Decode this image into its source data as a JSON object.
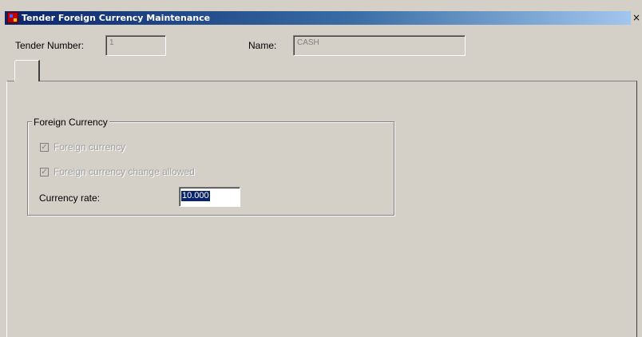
{
  "window": {
    "title": "Tender Foreign Currency Maintenance",
    "close_glyph": "×",
    "icon": "app-grid-icon"
  },
  "header": {
    "tender_number_label": "Tender Number:",
    "tender_number_value": "1",
    "name_label": "Name:",
    "name_value": "CASH"
  },
  "tabs": [
    {
      "label": ""
    }
  ],
  "foreign_currency": {
    "group_title": "Foreign Currency",
    "foreign_currency_label": "Foreign currency",
    "foreign_currency_checked": true,
    "change_allowed_label": "Foreign currency change allowed",
    "change_allowed_checked": true,
    "rate_label": "Currency rate:",
    "rate_value": "10.000"
  },
  "colors": {
    "titlebar_start": "#0a246a",
    "titlebar_end": "#a6caf0",
    "face": "#d4d0c8",
    "selection": "#0a246a"
  }
}
